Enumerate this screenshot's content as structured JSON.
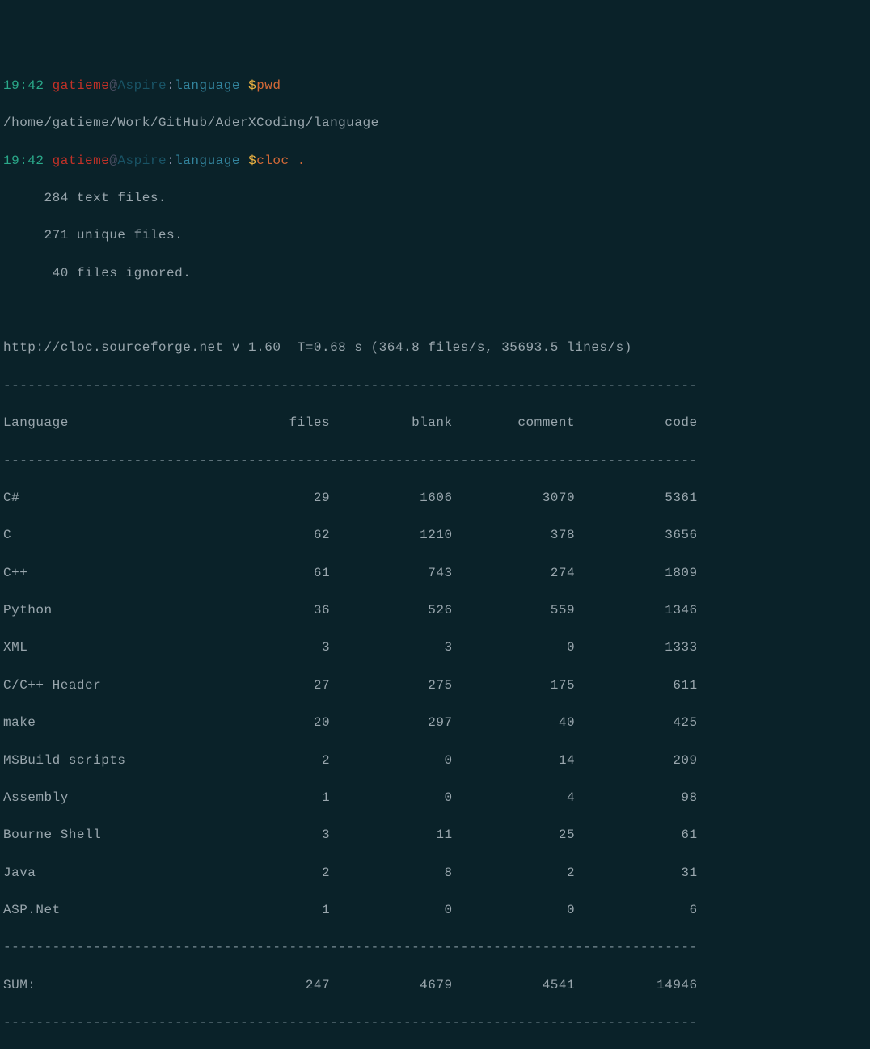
{
  "prompt1": {
    "time": "19:42",
    "user": "gatieme",
    "at": "@",
    "host": "Aspire",
    "colon": ":",
    "path": "language",
    "dollar": " $",
    "cmd": "pwd"
  },
  "pwd_output": "/home/gatieme/Work/GitHub/AderXCoding/language",
  "prompt2": {
    "time": "19:42",
    "user": "gatieme",
    "at": "@",
    "host": "Aspire",
    "colon": ":",
    "path": "language",
    "dollar": " $",
    "cmd": "cloc ."
  },
  "stats": {
    "line1": "     284 text files.",
    "line2": "     271 unique files.",
    "line3": "      40 files ignored."
  },
  "cloc_header": "http://cloc.sourceforge.net v 1.60  T=0.68 s (364.8 files/s, 35693.5 lines/s)",
  "sep": "-------------------------------------------------------------------------------------",
  "table_header": "Language                           files          blank        comment           code",
  "rows": [
    "C#                                    29           1606           3070           5361",
    "C                                     62           1210            378           3656",
    "C++                                   61            743            274           1809",
    "Python                                36            526            559           1346",
    "XML                                    3              3              0           1333",
    "C/C++ Header                          27            275            175            611",
    "make                                  20            297             40            425",
    "MSBuild scripts                        2              0             14            209",
    "Assembly                               1              0              4             98",
    "Bourne Shell                           3             11             25             61",
    "Java                                   2              8              2             31",
    "ASP.Net                                1              0              0              6"
  ],
  "sum": "SUM:                                 247           4679           4541          14946",
  "chart_data": {
    "type": "table",
    "title": "cloc output",
    "columns": [
      "Language",
      "files",
      "blank",
      "comment",
      "code"
    ],
    "rows": [
      {
        "Language": "C#",
        "files": 29,
        "blank": 1606,
        "comment": 3070,
        "code": 5361
      },
      {
        "Language": "C",
        "files": 62,
        "blank": 1210,
        "comment": 378,
        "code": 3656
      },
      {
        "Language": "C++",
        "files": 61,
        "blank": 743,
        "comment": 274,
        "code": 1809
      },
      {
        "Language": "Python",
        "files": 36,
        "blank": 526,
        "comment": 559,
        "code": 1346
      },
      {
        "Language": "XML",
        "files": 3,
        "blank": 3,
        "comment": 0,
        "code": 1333
      },
      {
        "Language": "C/C++ Header",
        "files": 27,
        "blank": 275,
        "comment": 175,
        "code": 611
      },
      {
        "Language": "make",
        "files": 20,
        "blank": 297,
        "comment": 40,
        "code": 425
      },
      {
        "Language": "MSBuild scripts",
        "files": 2,
        "blank": 0,
        "comment": 14,
        "code": 209
      },
      {
        "Language": "Assembly",
        "files": 1,
        "blank": 0,
        "comment": 4,
        "code": 98
      },
      {
        "Language": "Bourne Shell",
        "files": 3,
        "blank": 11,
        "comment": 25,
        "code": 61
      },
      {
        "Language": "Java",
        "files": 2,
        "blank": 8,
        "comment": 2,
        "code": 31
      },
      {
        "Language": "ASP.Net",
        "files": 1,
        "blank": 0,
        "comment": 0,
        "code": 6
      }
    ],
    "sum": {
      "files": 247,
      "blank": 4679,
      "comment": 4541,
      "code": 14946
    }
  }
}
